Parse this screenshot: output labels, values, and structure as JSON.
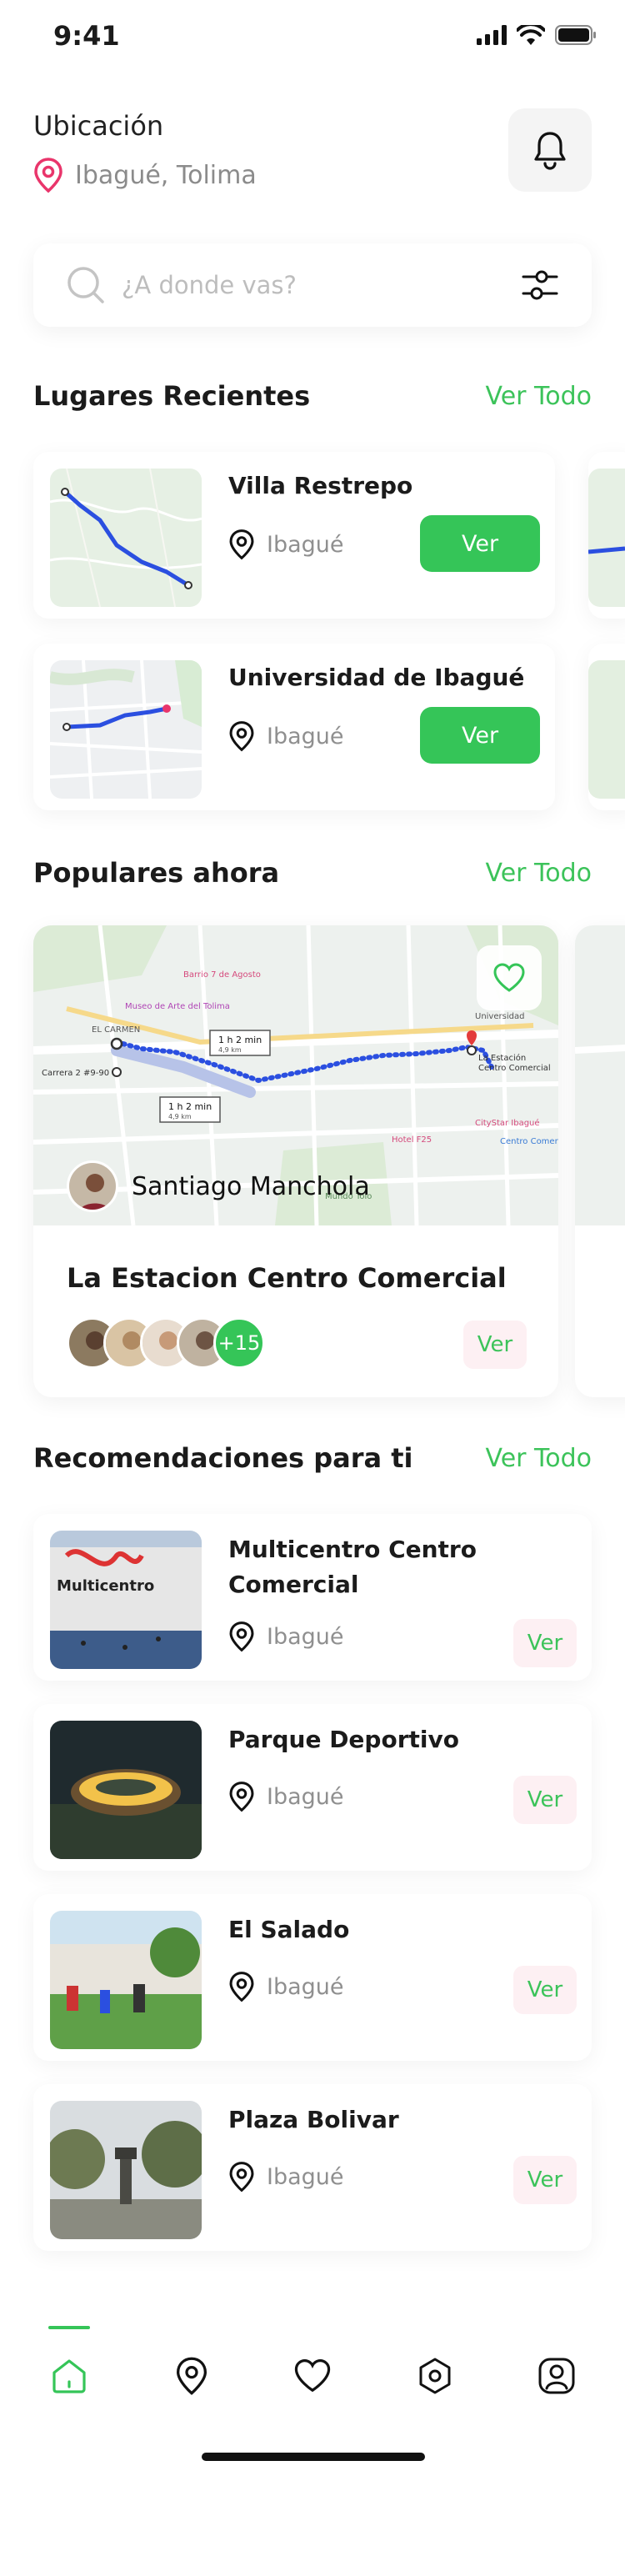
{
  "status_bar": {
    "time": "9:41"
  },
  "header": {
    "location_label": "Ubicación",
    "location_value": "Ibagué, Tolima"
  },
  "search": {
    "placeholder": "¿A donde vas?"
  },
  "recent": {
    "title": "Lugares Recientes",
    "see_all": "Ver Todo",
    "items": [
      {
        "name": "Villa Restrepo",
        "city": "Ibagué",
        "action": "Ver"
      },
      {
        "name": "Universidad de Ibagué",
        "city": "Ibagué",
        "action": "Ver"
      }
    ]
  },
  "popular": {
    "title": "Populares ahora",
    "see_all": "Ver Todo",
    "card": {
      "author": "Santiago Manchola",
      "place": "La Estacion Centro Comercial",
      "extra_count": "+15",
      "action": "Ver",
      "map_labels": {
        "start": "Carrera 2 #9-90",
        "end_line1": "La Estación",
        "end_line2": "Centro Comercial",
        "eta1": "1 h 2 min",
        "eta1_dist": "4,9 km",
        "eta2": "1 h 2 min",
        "eta2_dist": "4,9 km",
        "district": "EL CARMEN",
        "museum": "Museo de Arte del Tolima",
        "bar": "Barrio 7 de Agosto",
        "uni": "Universidad",
        "hotel": "Hotel F25",
        "citystar": "CityStar Ibagué",
        "cc": "Centro Comercial",
        "manolo": "Mundo Tolo"
      }
    }
  },
  "recommendations": {
    "title": "Recomendaciones para ti",
    "see_all": "Ver Todo",
    "items": [
      {
        "name": "Multicentro Centro Comercial",
        "city": "Ibagué",
        "action": "Ver"
      },
      {
        "name": "Parque Deportivo",
        "city": "Ibagué",
        "action": "Ver"
      },
      {
        "name": "El Salado",
        "city": "Ibagué",
        "action": "Ver"
      },
      {
        "name": "Plaza Bolivar",
        "city": "Ibagué",
        "action": "Ver"
      }
    ]
  },
  "photo_text": {
    "multicentro_sign": "Multicentro"
  },
  "tabs": [
    {
      "icon": "home-icon",
      "active": true
    },
    {
      "icon": "location-pin-icon",
      "active": false
    },
    {
      "icon": "heart-icon",
      "active": false
    },
    {
      "icon": "hexagon-settings-icon",
      "active": false
    },
    {
      "icon": "profile-icon",
      "active": false
    }
  ],
  "colors": {
    "accent": "#35c558",
    "pin": "#e9356b",
    "ver_pink_bg": "#fdf0f3",
    "route": "#2b4fe0"
  }
}
